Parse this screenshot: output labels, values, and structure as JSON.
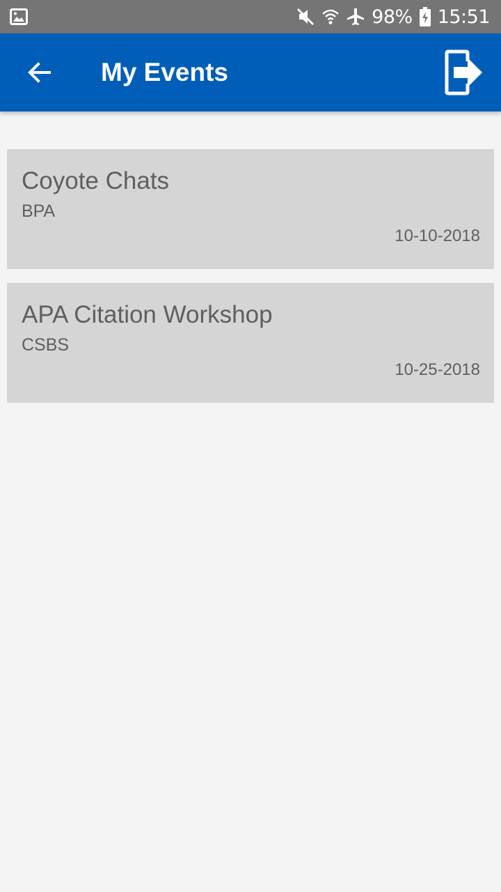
{
  "status_bar": {
    "battery": "98%",
    "time": "15:51",
    "icons": [
      "gallery-icon",
      "mute-icon",
      "wifi-icon",
      "airplane-icon",
      "battery-charging-icon"
    ]
  },
  "app_bar": {
    "title": "My Events",
    "back_icon": "arrow-left-icon",
    "logout_icon": "logout-icon",
    "color": "#005eb8"
  },
  "events": [
    {
      "title": "Coyote Chats",
      "org": "BPA",
      "date": "10-10-2018"
    },
    {
      "title": "APA Citation Workshop",
      "org": "CSBS",
      "date": "10-25-2018"
    }
  ]
}
